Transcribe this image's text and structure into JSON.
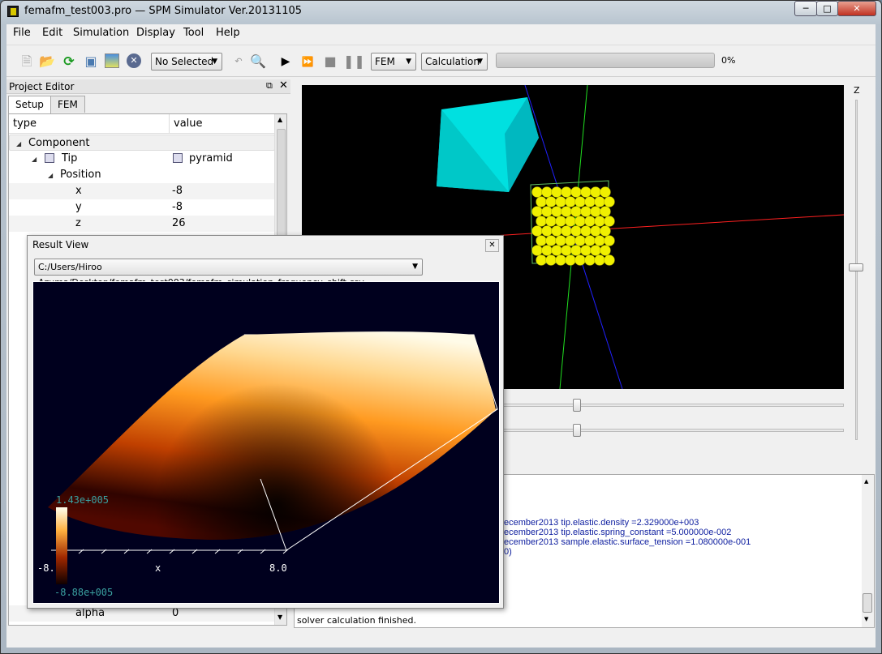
{
  "window": {
    "title": "femafm_test003.pro — SPM Simulator Ver.20131105",
    "controls": [
      "minimize",
      "maximize",
      "close"
    ]
  },
  "menu": [
    "File",
    "Edit",
    "Simulation",
    "Display",
    "Tool",
    "Help"
  ],
  "toolbar": {
    "icons": [
      "new-file-icon",
      "open-folder-icon",
      "reload-icon",
      "save-icon",
      "image-icon",
      "close-circle-icon",
      "back-icon",
      "zoom-in-icon",
      "play-icon",
      "fast-forward-icon",
      "stop-icon",
      "pause-icon"
    ],
    "selection": "No Selected",
    "mode": "FEM",
    "action": "Calculation",
    "progress_percent": 0,
    "progress_label": "0%"
  },
  "project_editor": {
    "title": "Project Editor",
    "tabs": [
      "Setup",
      "FEM"
    ],
    "active_tab": "Setup",
    "columns": [
      "type",
      "value"
    ],
    "rows": [
      {
        "type": "Component",
        "value": ""
      },
      {
        "type": "Tip",
        "value": "pyramid"
      },
      {
        "type": "Position",
        "value": ""
      },
      {
        "type": "x",
        "value": "-8"
      },
      {
        "type": "y",
        "value": "-8"
      },
      {
        "type": "z",
        "value": "26"
      },
      {
        "type": "alpha",
        "value": "0"
      }
    ]
  },
  "view3d": {
    "axis_label": "Z",
    "colors": {
      "tip": "#00e8e8",
      "atoms": "#f0f000",
      "x_axis": "#ff2020",
      "y_axis": "#20e020",
      "z_axis": "#2020ff"
    }
  },
  "result_view": {
    "title": "Result View",
    "file": "C:/Users/Hiroo Azuma/Desktop/femafm_test003/femafm_simulation_frequency_shift.csv",
    "colorbar_max": "1.43e+005",
    "colorbar_min": "-8.88e+005",
    "x_min_label": "-8.",
    "x_label": "x",
    "x_max_label": "8.0"
  },
  "log": {
    "lines": [
      "ecember2013 tip.elastic.density =2.329000e+003",
      "ecember2013 tip.elastic.spring_constant =5.000000e-002",
      "ecember2013 sample.elastic.surface_tension =1.080000e-001",
      "0)"
    ],
    "last": "solver calculation finished."
  }
}
